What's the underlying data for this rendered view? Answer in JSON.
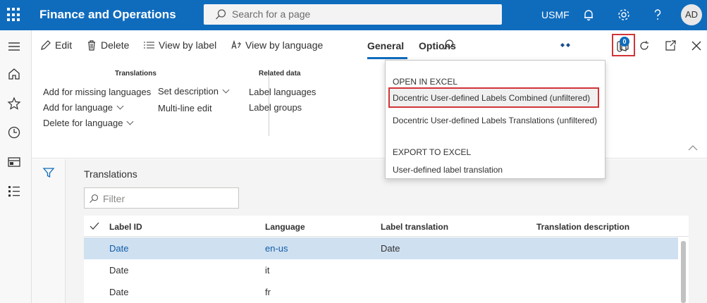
{
  "topbar": {
    "app_title": "Finance and Operations",
    "search_placeholder": "Search for a page",
    "company": "USMF",
    "avatar_initials": "AD"
  },
  "actionpane": {
    "edit": "Edit",
    "delete": "Delete",
    "view_by_label": "View by label",
    "view_by_language": "View by language",
    "tab_general": "General",
    "tab_options": "Options",
    "attachments_count": "0"
  },
  "ribbon": {
    "translations_title": "Translations",
    "add_missing": "Add for missing languages",
    "add_for_language": "Add for language",
    "delete_for_language": "Delete for language",
    "set_description": "Set description",
    "multi_line_edit": "Multi-line edit",
    "related_title": "Related data",
    "label_languages": "Label languages",
    "label_groups": "Label groups"
  },
  "main": {
    "section_title": "Translations",
    "filter_placeholder": "Filter",
    "columns": [
      "Label ID",
      "Language",
      "Label translation",
      "Translation description"
    ],
    "rows": [
      {
        "label_id": "Date",
        "language": "en-us",
        "translation": "Date",
        "description": ""
      },
      {
        "label_id": "Date",
        "language": "it",
        "translation": "",
        "description": ""
      },
      {
        "label_id": "Date",
        "language": "fr",
        "translation": "",
        "description": ""
      }
    ]
  },
  "dropdown": {
    "open_in_excel": "OPEN IN EXCEL",
    "item_combined": "Docentric User-defined Labels Combined (unfiltered)",
    "item_translations": "Docentric User-defined Labels Translations (unfiltered)",
    "export_to_excel": "EXPORT TO EXCEL",
    "item_export": "User-defined label translation"
  },
  "colors": {
    "brand": "#0f6cbd",
    "highlight_border": "#d13438",
    "selected_row": "#cfe0f1"
  }
}
